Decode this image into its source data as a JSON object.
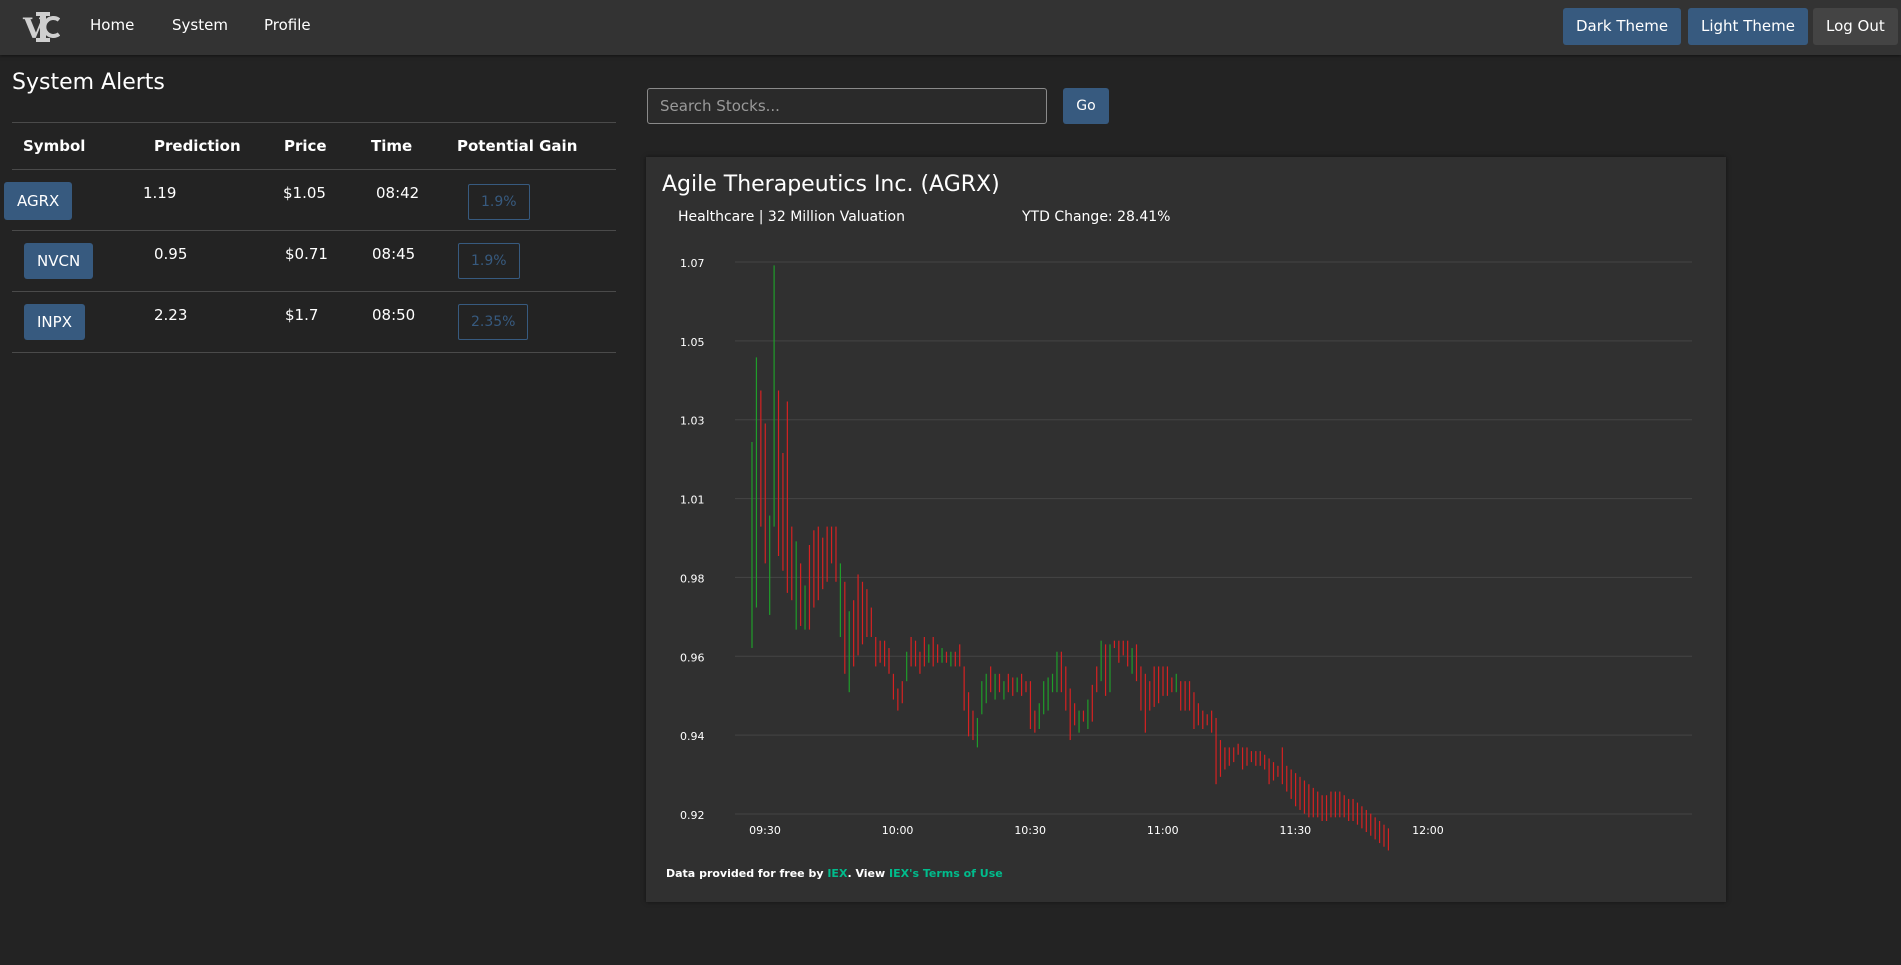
{
  "nav": {
    "logo_text": "VIC",
    "links": [
      "Home",
      "System",
      "Profile"
    ],
    "buttons": {
      "dark": "Dark Theme",
      "light": "Light Theme",
      "logout": "Log Out"
    }
  },
  "alerts": {
    "title": "System Alerts",
    "columns": [
      "Symbol",
      "Prediction",
      "Price",
      "Time",
      "Potential Gain"
    ],
    "rows": [
      {
        "symbol": "AGRX",
        "prediction": "1.19",
        "price": "$1.05",
        "time": "08:42",
        "gain": "1.9%"
      },
      {
        "symbol": "NVCN",
        "prediction": "0.95",
        "price": "$0.71",
        "time": "08:45",
        "gain": "1.9%"
      },
      {
        "symbol": "INPX",
        "prediction": "2.23",
        "price": "$1.7",
        "time": "08:50",
        "gain": "2.35%"
      }
    ]
  },
  "search": {
    "placeholder": "Search Stocks...",
    "value": "",
    "go_label": "Go"
  },
  "stock": {
    "name": "Agile Therapeutics Inc. (AGRX)",
    "meta": "Healthcare | 32 Million Valuation",
    "ytd": "YTD Change: 28.41%"
  },
  "footer": {
    "prefix": "Data provided for free by ",
    "iex": "IEX",
    "middle": ". View ",
    "terms": "IEX's Terms of Use"
  },
  "colors": {
    "up": "#1f9d2a",
    "down": "#d62222",
    "accent": "#375a7f",
    "link": "#00bc8c"
  },
  "chart_data": {
    "type": "bar",
    "style": "ohlc-ticks",
    "y_ticks": [
      "1.07",
      "1.05",
      "1.03",
      "1.01",
      "0.98",
      "0.96",
      "0.94",
      "0.92"
    ],
    "x_ticks": [
      "09:30",
      "10:00",
      "10:30",
      "11:00",
      "11:30",
      "12:00"
    ],
    "ylim": [
      0.92,
      1.07
    ],
    "xlim_minutes": [
      570,
      744
    ],
    "grid": true,
    "series": [
      {
        "t": 570,
        "low": 0.967,
        "high": 1.023,
        "dir": "up"
      },
      {
        "t": 571,
        "low": 0.978,
        "high": 1.046,
        "dir": "up"
      },
      {
        "t": 572,
        "low": 1.0,
        "high": 1.037,
        "dir": "down"
      },
      {
        "t": 573,
        "low": 0.99,
        "high": 1.028,
        "dir": "down"
      },
      {
        "t": 574,
        "low": 0.976,
        "high": 1.003,
        "dir": "up"
      },
      {
        "t": 575,
        "low": 1.0,
        "high": 1.071,
        "dir": "up"
      },
      {
        "t": 576,
        "low": 0.992,
        "high": 1.037,
        "dir": "down"
      },
      {
        "t": 577,
        "low": 0.988,
        "high": 1.02,
        "dir": "down"
      },
      {
        "t": 578,
        "low": 0.982,
        "high": 1.034,
        "dir": "down"
      },
      {
        "t": 579,
        "low": 0.98,
        "high": 1.0,
        "dir": "down"
      },
      {
        "t": 580,
        "low": 0.972,
        "high": 0.996,
        "dir": "up"
      },
      {
        "t": 581,
        "low": 0.973,
        "high": 0.99,
        "dir": "down"
      },
      {
        "t": 582,
        "low": 0.972,
        "high": 0.984,
        "dir": "up"
      },
      {
        "t": 583,
        "low": 0.972,
        "high": 0.995,
        "dir": "down"
      },
      {
        "t": 584,
        "low": 0.978,
        "high": 0.999,
        "dir": "down"
      },
      {
        "t": 585,
        "low": 0.98,
        "high": 1.0,
        "dir": "down"
      },
      {
        "t": 586,
        "low": 0.983,
        "high": 0.997,
        "dir": "down"
      },
      {
        "t": 587,
        "low": 0.985,
        "high": 1.0,
        "dir": "down"
      },
      {
        "t": 588,
        "low": 0.99,
        "high": 1.0,
        "dir": "down"
      },
      {
        "t": 589,
        "low": 0.985,
        "high": 1.0,
        "dir": "down"
      },
      {
        "t": 590,
        "low": 0.97,
        "high": 0.99,
        "dir": "up"
      },
      {
        "t": 591,
        "low": 0.96,
        "high": 0.985,
        "dir": "down"
      },
      {
        "t": 592,
        "low": 0.955,
        "high": 0.977,
        "dir": "up"
      },
      {
        "t": 593,
        "low": 0.962,
        "high": 0.98,
        "dir": "down"
      },
      {
        "t": 594,
        "low": 0.965,
        "high": 0.987,
        "dir": "down"
      },
      {
        "t": 595,
        "low": 0.968,
        "high": 0.985,
        "dir": "down"
      },
      {
        "t": 596,
        "low": 0.97,
        "high": 0.983,
        "dir": "down"
      },
      {
        "t": 597,
        "low": 0.97,
        "high": 0.978,
        "dir": "down"
      },
      {
        "t": 598,
        "low": 0.962,
        "high": 0.97,
        "dir": "down"
      },
      {
        "t": 599,
        "low": 0.963,
        "high": 0.969,
        "dir": "down"
      },
      {
        "t": 600,
        "low": 0.962,
        "high": 0.969,
        "dir": "down"
      },
      {
        "t": 601,
        "low": 0.96,
        "high": 0.967,
        "dir": "down"
      },
      {
        "t": 602,
        "low": 0.953,
        "high": 0.96,
        "dir": "down"
      },
      {
        "t": 603,
        "low": 0.95,
        "high": 0.956,
        "dir": "down"
      },
      {
        "t": 604,
        "low": 0.952,
        "high": 0.958,
        "dir": "down"
      },
      {
        "t": 605,
        "low": 0.958,
        "high": 0.966,
        "dir": "up"
      },
      {
        "t": 606,
        "low": 0.962,
        "high": 0.97,
        "dir": "down"
      },
      {
        "t": 607,
        "low": 0.962,
        "high": 0.969,
        "dir": "down"
      },
      {
        "t": 608,
        "low": 0.96,
        "high": 0.966,
        "dir": "down"
      },
      {
        "t": 609,
        "low": 0.962,
        "high": 0.97,
        "dir": "down"
      },
      {
        "t": 610,
        "low": 0.963,
        "high": 0.968,
        "dir": "up"
      },
      {
        "t": 611,
        "low": 0.962,
        "high": 0.97,
        "dir": "down"
      },
      {
        "t": 612,
        "low": 0.963,
        "high": 0.968,
        "dir": "down"
      },
      {
        "t": 613,
        "low": 0.963,
        "high": 0.967,
        "dir": "up"
      },
      {
        "t": 614,
        "low": 0.963,
        "high": 0.966,
        "dir": "down"
      },
      {
        "t": 615,
        "low": 0.962,
        "high": 0.966,
        "dir": "up"
      },
      {
        "t": 616,
        "low": 0.962,
        "high": 0.966,
        "dir": "down"
      },
      {
        "t": 617,
        "low": 0.962,
        "high": 0.968,
        "dir": "down"
      },
      {
        "t": 618,
        "low": 0.95,
        "high": 0.962,
        "dir": "down"
      },
      {
        "t": 619,
        "low": 0.943,
        "high": 0.955,
        "dir": "down"
      },
      {
        "t": 620,
        "low": 0.942,
        "high": 0.95,
        "dir": "down"
      },
      {
        "t": 621,
        "low": 0.94,
        "high": 0.948,
        "dir": "up"
      },
      {
        "t": 622,
        "low": 0.949,
        "high": 0.958,
        "dir": "up"
      },
      {
        "t": 623,
        "low": 0.952,
        "high": 0.96,
        "dir": "up"
      },
      {
        "t": 624,
        "low": 0.955,
        "high": 0.962,
        "dir": "down"
      },
      {
        "t": 625,
        "low": 0.953,
        "high": 0.96,
        "dir": "up"
      },
      {
        "t": 626,
        "low": 0.955,
        "high": 0.96,
        "dir": "down"
      },
      {
        "t": 627,
        "low": 0.953,
        "high": 0.958,
        "dir": "up"
      },
      {
        "t": 628,
        "low": 0.955,
        "high": 0.96,
        "dir": "down"
      },
      {
        "t": 629,
        "low": 0.954,
        "high": 0.959,
        "dir": "down"
      },
      {
        "t": 630,
        "low": 0.955,
        "high": 0.959,
        "dir": "up"
      },
      {
        "t": 631,
        "low": 0.954,
        "high": 0.96,
        "dir": "down"
      },
      {
        "t": 632,
        "low": 0.955,
        "high": 0.958,
        "dir": "down"
      },
      {
        "t": 633,
        "low": 0.945,
        "high": 0.958,
        "dir": "down"
      },
      {
        "t": 634,
        "low": 0.944,
        "high": 0.95,
        "dir": "down"
      },
      {
        "t": 635,
        "low": 0.945,
        "high": 0.952,
        "dir": "up"
      },
      {
        "t": 636,
        "low": 0.949,
        "high": 0.958,
        "dir": "up"
      },
      {
        "t": 637,
        "low": 0.95,
        "high": 0.959,
        "dir": "up"
      },
      {
        "t": 638,
        "low": 0.955,
        "high": 0.96,
        "dir": "up"
      },
      {
        "t": 639,
        "low": 0.955,
        "high": 0.966,
        "dir": "up"
      },
      {
        "t": 640,
        "low": 0.955,
        "high": 0.966,
        "dir": "down"
      },
      {
        "t": 641,
        "low": 0.95,
        "high": 0.962,
        "dir": "down"
      },
      {
        "t": 642,
        "low": 0.942,
        "high": 0.956,
        "dir": "down"
      },
      {
        "t": 643,
        "low": 0.946,
        "high": 0.952,
        "dir": "down"
      },
      {
        "t": 644,
        "low": 0.944,
        "high": 0.95,
        "dir": "up"
      },
      {
        "t": 645,
        "low": 0.947,
        "high": 0.95,
        "dir": "down"
      },
      {
        "t": 646,
        "low": 0.945,
        "high": 0.953,
        "dir": "up"
      },
      {
        "t": 647,
        "low": 0.947,
        "high": 0.957,
        "dir": "down"
      },
      {
        "t": 648,
        "low": 0.955,
        "high": 0.962,
        "dir": "down"
      },
      {
        "t": 649,
        "low": 0.958,
        "high": 0.969,
        "dir": "up"
      },
      {
        "t": 650,
        "low": 0.954,
        "high": 0.968,
        "dir": "down"
      },
      {
        "t": 651,
        "low": 0.955,
        "high": 0.968,
        "dir": "up"
      },
      {
        "t": 652,
        "low": 0.967,
        "high": 0.969,
        "dir": "down"
      },
      {
        "t": 653,
        "low": 0.963,
        "high": 0.969,
        "dir": "down"
      },
      {
        "t": 654,
        "low": 0.965,
        "high": 0.969,
        "dir": "down"
      },
      {
        "t": 655,
        "low": 0.962,
        "high": 0.969,
        "dir": "down"
      },
      {
        "t": 656,
        "low": 0.96,
        "high": 0.967,
        "dir": "up"
      },
      {
        "t": 657,
        "low": 0.958,
        "high": 0.968,
        "dir": "down"
      },
      {
        "t": 658,
        "low": 0.95,
        "high": 0.962,
        "dir": "down"
      },
      {
        "t": 659,
        "low": 0.944,
        "high": 0.96,
        "dir": "down"
      },
      {
        "t": 660,
        "low": 0.95,
        "high": 0.958,
        "dir": "down"
      },
      {
        "t": 661,
        "low": 0.951,
        "high": 0.962,
        "dir": "down"
      },
      {
        "t": 662,
        "low": 0.952,
        "high": 0.962,
        "dir": "down"
      },
      {
        "t": 663,
        "low": 0.954,
        "high": 0.962,
        "dir": "down"
      },
      {
        "t": 664,
        "low": 0.954,
        "high": 0.962,
        "dir": "down"
      },
      {
        "t": 665,
        "low": 0.955,
        "high": 0.959,
        "dir": "down"
      },
      {
        "t": 666,
        "low": 0.955,
        "high": 0.96,
        "dir": "up"
      },
      {
        "t": 667,
        "low": 0.95,
        "high": 0.958,
        "dir": "down"
      },
      {
        "t": 668,
        "low": 0.95,
        "high": 0.958,
        "dir": "down"
      },
      {
        "t": 669,
        "low": 0.95,
        "high": 0.958,
        "dir": "down"
      },
      {
        "t": 670,
        "low": 0.945,
        "high": 0.955,
        "dir": "down"
      },
      {
        "t": 671,
        "low": 0.946,
        "high": 0.952,
        "dir": "down"
      },
      {
        "t": 672,
        "low": 0.945,
        "high": 0.95,
        "dir": "down"
      },
      {
        "t": 673,
        "low": 0.946,
        "high": 0.949,
        "dir": "down"
      },
      {
        "t": 674,
        "low": 0.944,
        "high": 0.95,
        "dir": "down"
      },
      {
        "t": 675,
        "low": 0.93,
        "high": 0.948,
        "dir": "down"
      },
      {
        "t": 676,
        "low": 0.932,
        "high": 0.942,
        "dir": "down"
      },
      {
        "t": 677,
        "low": 0.934,
        "high": 0.94,
        "dir": "down"
      },
      {
        "t": 678,
        "low": 0.935,
        "high": 0.94,
        "dir": "down"
      },
      {
        "t": 679,
        "low": 0.936,
        "high": 0.94,
        "dir": "down"
      },
      {
        "t": 680,
        "low": 0.938,
        "high": 0.941,
        "dir": "down"
      },
      {
        "t": 681,
        "low": 0.934,
        "high": 0.94,
        "dir": "down"
      },
      {
        "t": 682,
        "low": 0.935,
        "high": 0.94,
        "dir": "down"
      },
      {
        "t": 683,
        "low": 0.936,
        "high": 0.939,
        "dir": "down"
      },
      {
        "t": 684,
        "low": 0.935,
        "high": 0.939,
        "dir": "down"
      },
      {
        "t": 685,
        "low": 0.935,
        "high": 0.939,
        "dir": "down"
      },
      {
        "t": 686,
        "low": 0.934,
        "high": 0.938,
        "dir": "down"
      },
      {
        "t": 687,
        "low": 0.93,
        "high": 0.937,
        "dir": "down"
      },
      {
        "t": 688,
        "low": 0.931,
        "high": 0.936,
        "dir": "down"
      },
      {
        "t": 689,
        "low": 0.932,
        "high": 0.935,
        "dir": "down"
      },
      {
        "t": 690,
        "low": 0.93,
        "high": 0.94,
        "dir": "down"
      },
      {
        "t": 691,
        "low": 0.928,
        "high": 0.935,
        "dir": "down"
      },
      {
        "t": 692,
        "low": 0.926,
        "high": 0.934,
        "dir": "down"
      },
      {
        "t": 693,
        "low": 0.924,
        "high": 0.933,
        "dir": "down"
      },
      {
        "t": 694,
        "low": 0.923,
        "high": 0.932,
        "dir": "down"
      },
      {
        "t": 695,
        "low": 0.922,
        "high": 0.931,
        "dir": "down"
      },
      {
        "t": 696,
        "low": 0.921,
        "high": 0.93,
        "dir": "down"
      },
      {
        "t": 697,
        "low": 0.921,
        "high": 0.929,
        "dir": "down"
      },
      {
        "t": 698,
        "low": 0.921,
        "high": 0.928,
        "dir": "down"
      },
      {
        "t": 699,
        "low": 0.92,
        "high": 0.927,
        "dir": "down"
      },
      {
        "t": 700,
        "low": 0.92,
        "high": 0.927,
        "dir": "down"
      },
      {
        "t": 701,
        "low": 0.921,
        "high": 0.928,
        "dir": "down"
      },
      {
        "t": 702,
        "low": 0.921,
        "high": 0.928,
        "dir": "down"
      },
      {
        "t": 703,
        "low": 0.921,
        "high": 0.928,
        "dir": "down"
      },
      {
        "t": 704,
        "low": 0.921,
        "high": 0.927,
        "dir": "down"
      },
      {
        "t": 705,
        "low": 0.92,
        "high": 0.926,
        "dir": "down"
      },
      {
        "t": 706,
        "low": 0.92,
        "high": 0.926,
        "dir": "down"
      },
      {
        "t": 707,
        "low": 0.919,
        "high": 0.925,
        "dir": "down"
      },
      {
        "t": 708,
        "low": 0.918,
        "high": 0.924,
        "dir": "down"
      },
      {
        "t": 709,
        "low": 0.917,
        "high": 0.923,
        "dir": "down"
      },
      {
        "t": 710,
        "low": 0.916,
        "high": 0.922,
        "dir": "down"
      },
      {
        "t": 711,
        "low": 0.915,
        "high": 0.921,
        "dir": "down"
      },
      {
        "t": 712,
        "low": 0.914,
        "high": 0.92,
        "dir": "down"
      },
      {
        "t": 713,
        "low": 0.913,
        "high": 0.919,
        "dir": "down"
      },
      {
        "t": 714,
        "low": 0.912,
        "high": 0.918,
        "dir": "down"
      }
    ]
  }
}
